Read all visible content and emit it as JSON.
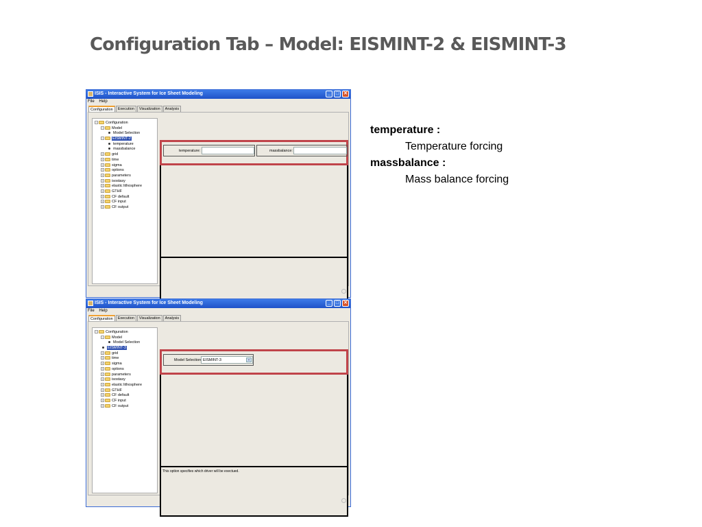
{
  "slide": {
    "title": "Configuration Tab – Model: EISMINT-2 & EISMINT-3"
  },
  "window": {
    "title": "ISIS - Interactive System for Ice Sheet Modeling",
    "menu": [
      "File",
      "Help"
    ],
    "tabs": [
      "Configuration",
      "Execution",
      "Visualization",
      "Analysis"
    ],
    "controls": {
      "minimize": "_",
      "maximize": "□",
      "close": "✕"
    }
  },
  "screen1": {
    "tree": [
      {
        "label": "Configuration",
        "level": 0,
        "type": "folder",
        "exp": "−"
      },
      {
        "label": "Model",
        "level": 1,
        "type": "folder",
        "exp": "−"
      },
      {
        "label": "Model Selection",
        "level": 2,
        "type": "leaf"
      },
      {
        "label": "EISMINT-2",
        "level": 1,
        "type": "folder",
        "exp": "−",
        "selected": true
      },
      {
        "label": "temperature",
        "level": 2,
        "type": "leaf"
      },
      {
        "label": "massbalance",
        "level": 2,
        "type": "leaf"
      },
      {
        "label": "grid",
        "level": 1,
        "type": "folder",
        "exp": "+"
      },
      {
        "label": "time",
        "level": 1,
        "type": "folder",
        "exp": "+"
      },
      {
        "label": "sigma",
        "level": 1,
        "type": "folder",
        "exp": "+"
      },
      {
        "label": "options",
        "level": 1,
        "type": "folder",
        "exp": "+"
      },
      {
        "label": "parameters",
        "level": 1,
        "type": "folder",
        "exp": "+"
      },
      {
        "label": "isostasy",
        "level": 1,
        "type": "folder",
        "exp": "+"
      },
      {
        "label": "elastic lithosphere",
        "level": 1,
        "type": "folder",
        "exp": "+"
      },
      {
        "label": "GTHF",
        "level": 1,
        "type": "folder",
        "exp": "+"
      },
      {
        "label": "CF default",
        "level": 1,
        "type": "folder",
        "exp": "+"
      },
      {
        "label": "CF input",
        "level": 1,
        "type": "folder",
        "exp": "+"
      },
      {
        "label": "CF output",
        "level": 1,
        "type": "folder",
        "exp": "+"
      }
    ],
    "temperature_label": "temperature:",
    "temperature_value": "",
    "massbalance_label": "massbalance:",
    "massbalance_value": "",
    "description": ""
  },
  "screen2": {
    "tree": [
      {
        "label": "Configuration",
        "level": 0,
        "type": "folder",
        "exp": "−"
      },
      {
        "label": "Model",
        "level": 1,
        "type": "folder",
        "exp": "−"
      },
      {
        "label": "Model Selection",
        "level": 2,
        "type": "leaf"
      },
      {
        "label": "EISMINT-3",
        "level": 1,
        "type": "leaf",
        "selected": true
      },
      {
        "label": "grid",
        "level": 1,
        "type": "folder",
        "exp": "+"
      },
      {
        "label": "time",
        "level": 1,
        "type": "folder",
        "exp": "+"
      },
      {
        "label": "sigma",
        "level": 1,
        "type": "folder",
        "exp": "+"
      },
      {
        "label": "options",
        "level": 1,
        "type": "folder",
        "exp": "+"
      },
      {
        "label": "parameters",
        "level": 1,
        "type": "folder",
        "exp": "+"
      },
      {
        "label": "isostasy",
        "level": 1,
        "type": "folder",
        "exp": "+"
      },
      {
        "label": "elastic lithosphere",
        "level": 1,
        "type": "folder",
        "exp": "+"
      },
      {
        "label": "GTHF",
        "level": 1,
        "type": "folder",
        "exp": "+"
      },
      {
        "label": "CF default",
        "level": 1,
        "type": "folder",
        "exp": "+"
      },
      {
        "label": "CF input",
        "level": 1,
        "type": "folder",
        "exp": "+"
      },
      {
        "label": "CF output",
        "level": 1,
        "type": "folder",
        "exp": "+"
      }
    ],
    "model_selection_label": "Model Selection:",
    "model_selection_value": "EISMINT-3",
    "description": "This option specifies which driver will be exectued."
  },
  "notes": [
    {
      "term": "temperature :",
      "definition": "Temperature forcing"
    },
    {
      "term": "massbalance :",
      "definition": "Mass balance forcing"
    }
  ],
  "colors": {
    "highlight": "#c0444a",
    "titlebar": "#1f52c8",
    "selection": "#2d4fb0"
  }
}
